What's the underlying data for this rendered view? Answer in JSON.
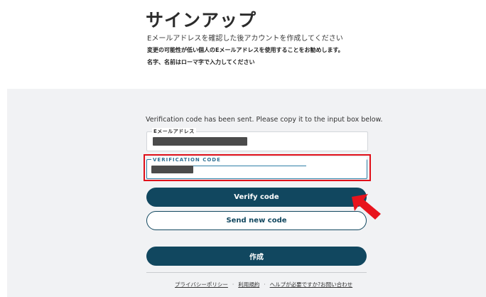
{
  "header": {
    "title": "サインアップ",
    "line1": "Eメールアドレスを確認した後アカウントを作成してください",
    "line2": "変更の可能性が低い個人のEメールアドレスを使用することをお勧めします。",
    "line3": "名字、名前はローマ字で入力してください"
  },
  "form": {
    "notice": "Verification code has been sent. Please copy it to the input box below.",
    "email": {
      "label": "Eメールアドレス"
    },
    "code": {
      "label": "VERIFICATION CODE"
    },
    "verify_label": "Verify code",
    "send_new_label": "Send new code",
    "create_label": "作成"
  },
  "footer": {
    "privacy": "プライバシーポリシー",
    "terms": "利用規約",
    "help": "ヘルプが必要ですか?お問い合わせ"
  },
  "colors": {
    "primary": "#11475f",
    "highlight": "#e0101a",
    "panel": "#f1f2f4"
  },
  "icons": {
    "arrow": "red-pointer-arrow-icon"
  }
}
